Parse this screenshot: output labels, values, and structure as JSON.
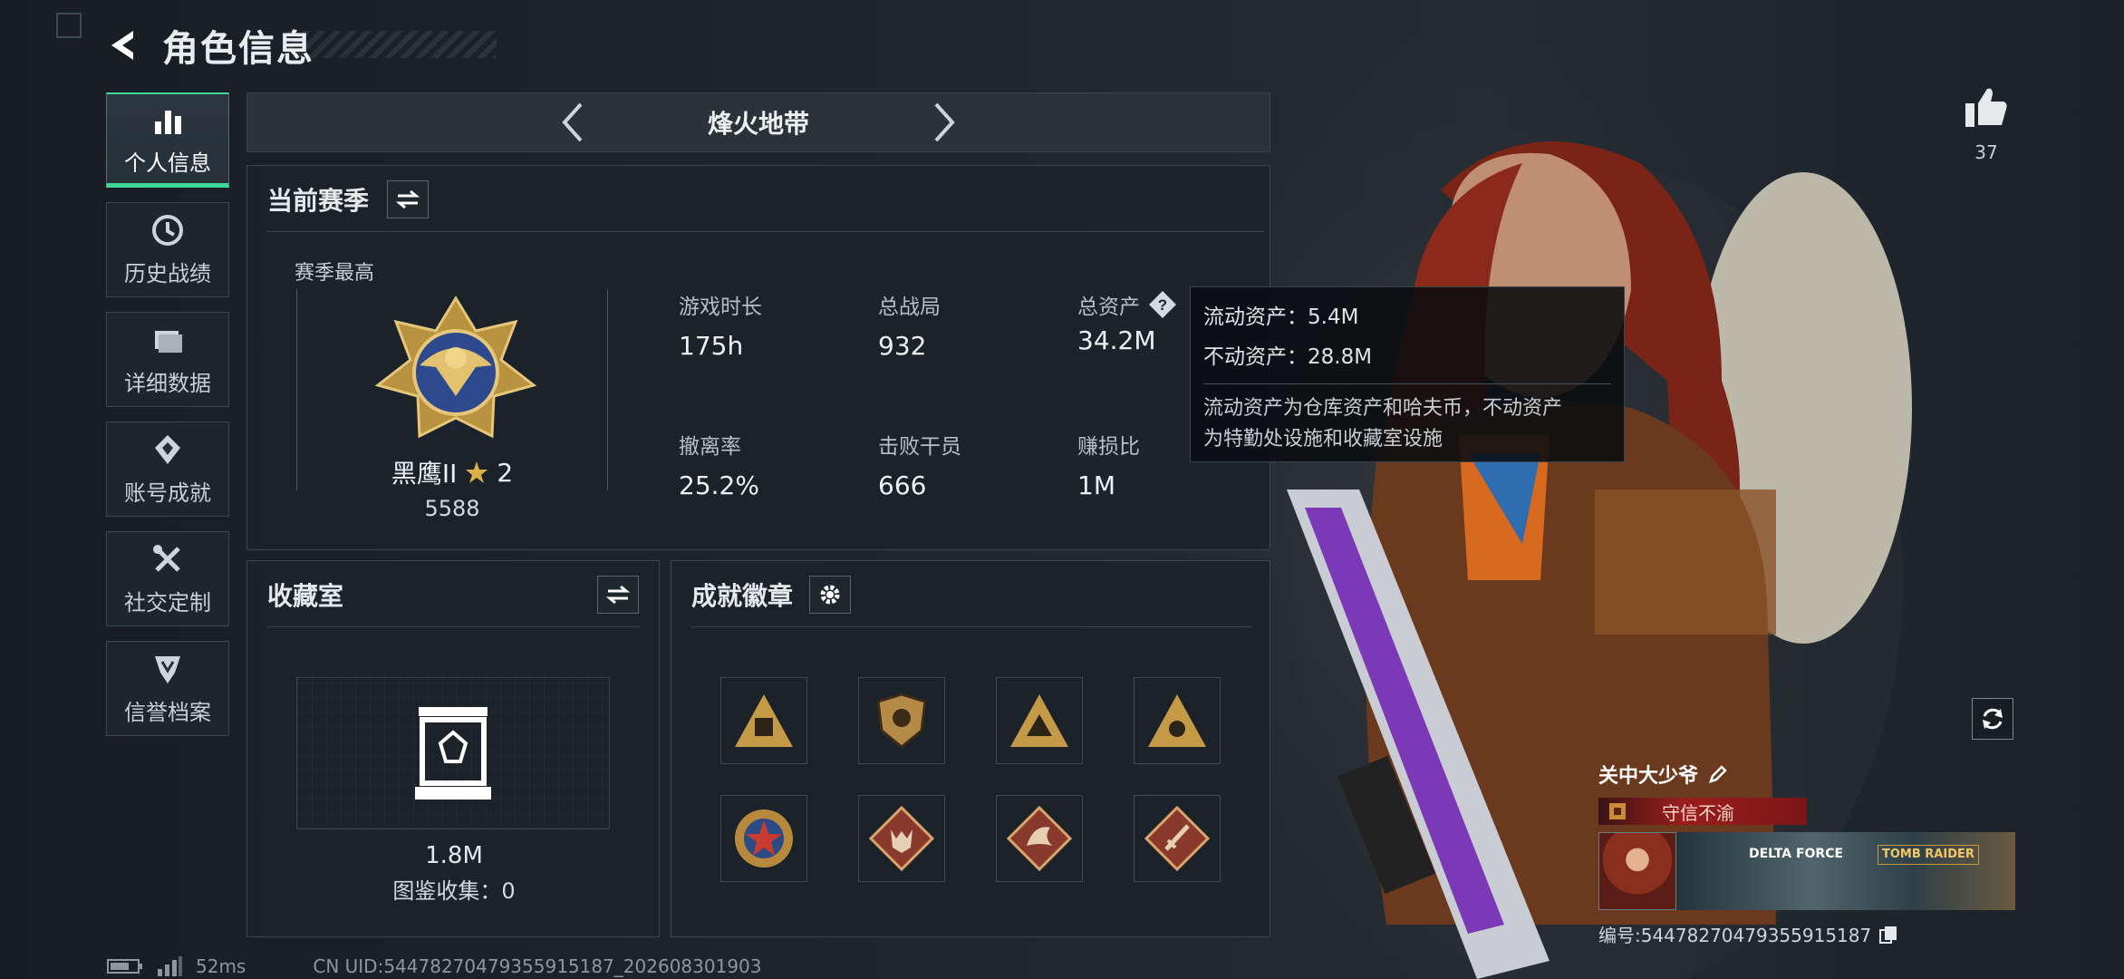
{
  "header": {
    "title": "角色信息"
  },
  "sidebar": {
    "items": [
      {
        "label": "个人信息",
        "icon": "bar-chart-icon",
        "active": true
      },
      {
        "label": "历史战绩",
        "icon": "history-clock-icon"
      },
      {
        "label": "详细数据",
        "icon": "folder-icon"
      },
      {
        "label": "账号成就",
        "icon": "achievement-icon"
      },
      {
        "label": "社交定制",
        "icon": "tools-icon"
      },
      {
        "label": "信誉档案",
        "icon": "credit-shield-icon"
      }
    ]
  },
  "season_nav": {
    "name": "烽火地带"
  },
  "current_season": {
    "title": "当前赛季",
    "best_label": "赛季最高",
    "rank_name": "黑鹰II",
    "rank_stars": "2",
    "rank_score": "5588",
    "stats": [
      {
        "label": "游戏时长",
        "value": "175h"
      },
      {
        "label": "总战局",
        "value": "932"
      },
      {
        "label": "总资产",
        "value": "34.2M"
      },
      {
        "label": "撤离率",
        "value": "25.2%"
      },
      {
        "label": "击败干员",
        "value": "666"
      },
      {
        "label": "赚损比",
        "value": "1M"
      }
    ]
  },
  "tooltip": {
    "liquid": "流动资产：5.4M",
    "fixed": "不动资产：28.8M",
    "desc_1": "流动资产为仓库资产和哈夫币，不动资产",
    "desc_2": "为特勤处设施和收藏室设施"
  },
  "collection": {
    "title": "收藏室",
    "value": "1.8M",
    "catalog": "图鉴收集：0"
  },
  "badges": {
    "title": "成就徽章",
    "items": [
      "triangle-badge-1",
      "shield-badge",
      "triangle-badge-2",
      "triangle-badge-3",
      "star-medal-badge",
      "wolf-badge",
      "dragon-badge",
      "sword-badge"
    ]
  },
  "likes": {
    "count": "37"
  },
  "player": {
    "name": "关中大少爷",
    "title": "守信不渝",
    "banner_left": "DELTA FORCE",
    "banner_right": "TOMB RAIDER",
    "id": "编号:5447827047935591518​7"
  },
  "footer": {
    "ping": "52ms",
    "uid": "CN UID:544782704793559151​87_202608301903"
  },
  "colors": {
    "accent": "#3fd79a",
    "gold": "#c9a24c",
    "title_red": "#9b1d1d"
  }
}
